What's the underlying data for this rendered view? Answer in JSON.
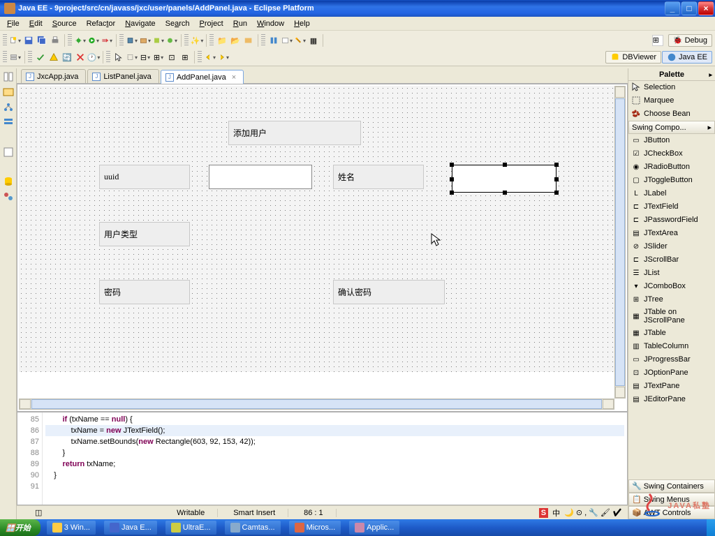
{
  "titlebar": {
    "text": "Java EE - 9project/src/cn/javass/jxc/user/panels/AddPanel.java - Eclipse Platform"
  },
  "menu": {
    "file": "File",
    "edit": "Edit",
    "source": "Source",
    "refactor": "Refactor",
    "navigate": "Navigate",
    "search": "Search",
    "project": "Project",
    "run": "Run",
    "window": "Window",
    "help": "Help"
  },
  "perspectives": {
    "debug": "Debug",
    "dbviewer": "DBViewer",
    "javaee": "Java EE"
  },
  "tabs": {
    "jxcapp": "JxcApp.java",
    "listpanel": "ListPanel.java",
    "addpanel": "AddPanel.java"
  },
  "labels": {
    "title": "添加用户",
    "uuid": "uuid",
    "name": "姓名",
    "usertype": "用户类型",
    "password": "密码",
    "confirm": "确认密码"
  },
  "palette": {
    "title": "Palette",
    "tools": {
      "selection": "Selection",
      "marquee": "Marquee",
      "choosebean": "Choose Bean"
    },
    "groups": {
      "swingcomp": "Swing Compo...",
      "swingcont": "Swing Containers",
      "swingmenus": "Swing Menus",
      "awt": "AWT Controls"
    },
    "items": [
      "JButton",
      "JCheckBox",
      "JRadioButton",
      "JToggleButton",
      "JLabel",
      "JTextField",
      "JPasswordField",
      "JTextArea",
      "JSlider",
      "JScrollBar",
      "JList",
      "JComboBox",
      "JTree",
      "JTable on\nJScrollPane",
      "JTable",
      "TableColumn",
      "JProgressBar",
      "JOptionPane",
      "JTextPane",
      "JEditorPane"
    ]
  },
  "source": {
    "lines": [
      "85",
      "86",
      "87",
      "88",
      "89",
      "90",
      "91"
    ],
    "l85_a": "if",
    "l85_b": " (txName == ",
    "l85_c": "null",
    "l85_d": ") {",
    "l86_a": "    txName = ",
    "l86_b": "new",
    "l86_c": " JTextField();",
    "l87_a": "    txName.setBounds(",
    "l87_b": "new",
    "l87_c": " Rectangle(603, 92, 153, 42));",
    "l88": "}",
    "l89_a": "return",
    "l89_b": " txName;",
    "l90": "}",
    "l91": ""
  },
  "status": {
    "writable": "Writable",
    "insert": "Smart Insert",
    "pos": "86 : 1"
  },
  "taskbar": {
    "start": "开始",
    "win3": "3 Win...",
    "javae": "Java E...",
    "ultrae": "UltraE...",
    "camtas": "Camtas...",
    "micros": "Micros...",
    "applic": "Applic..."
  },
  "tray": {
    "ime": "中"
  },
  "watermark": "JAVA私塾"
}
